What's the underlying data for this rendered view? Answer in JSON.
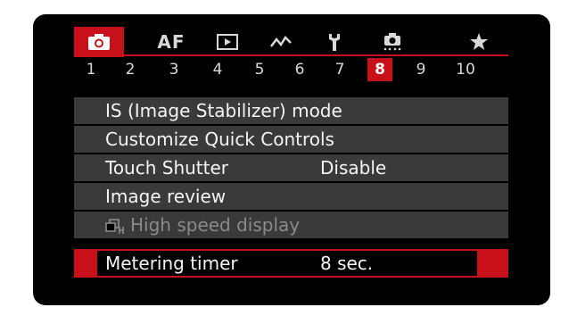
{
  "tabs": {
    "categories": [
      {
        "id": "shooting",
        "icon": "camera-icon",
        "active": true
      },
      {
        "id": "af",
        "label": "AF"
      },
      {
        "id": "playback",
        "icon": "playback-icon"
      },
      {
        "id": "wireless",
        "icon": "wireless-icon"
      },
      {
        "id": "setup",
        "icon": "wrench-icon"
      },
      {
        "id": "custom",
        "icon": "custom-functions-icon"
      },
      {
        "id": "mymenu",
        "icon": "star-icon"
      }
    ],
    "pages": [
      "1",
      "2",
      "3",
      "4",
      "5",
      "6",
      "7",
      "8",
      "9",
      "10"
    ],
    "active_page": "8",
    "accent_color": "#c8101a"
  },
  "menu": {
    "items": [
      {
        "label": "IS (Image Stabilizer) mode",
        "value": ""
      },
      {
        "label": "Customize Quick Controls",
        "value": ""
      },
      {
        "label": "Touch Shutter",
        "value": "Disable"
      },
      {
        "label": "Image review",
        "value": ""
      },
      {
        "label": "High speed display",
        "value": "",
        "disabled": true,
        "icon": "high-speed-continuous-icon"
      },
      {
        "label": "Metering timer",
        "value": "8 sec.",
        "selected": true
      }
    ]
  }
}
